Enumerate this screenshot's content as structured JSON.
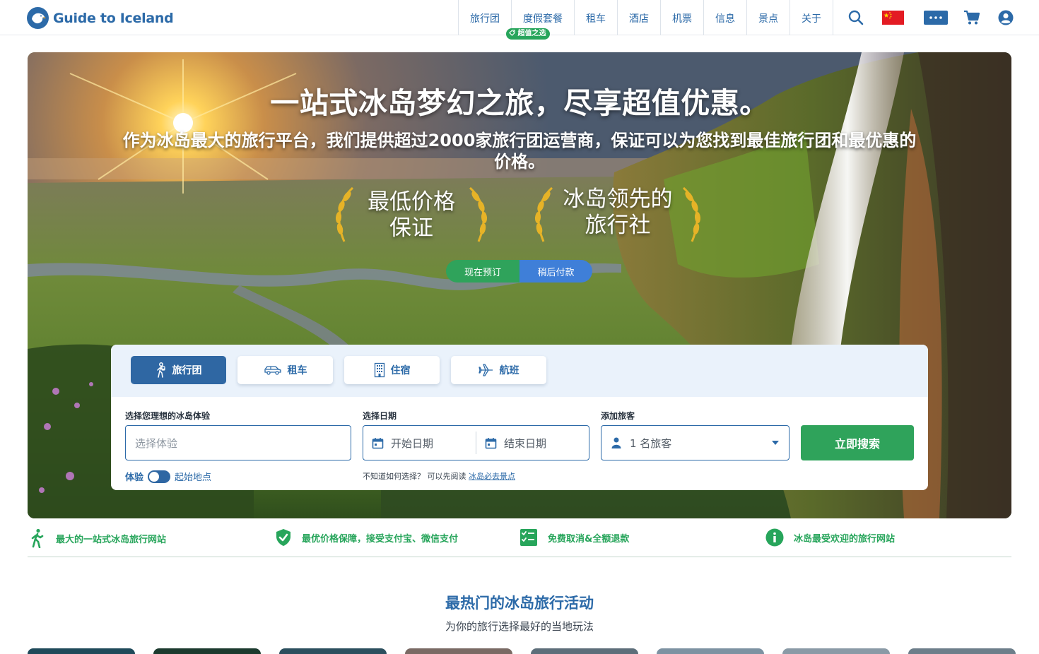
{
  "brand": {
    "name": "Guide to Iceland",
    "color": "#2c6aa8"
  },
  "nav": {
    "items": [
      "旅行团",
      "度假套餐",
      "租车",
      "酒店",
      "机票",
      "信息",
      "景点",
      "关于"
    ],
    "badge": "超值之选",
    "icons": [
      "search-icon",
      "china-flag-icon",
      "more-menu-icon",
      "cart-icon",
      "user-account-icon"
    ]
  },
  "hero": {
    "title": "一站式冰岛梦幻之旅，尽享超值优惠。",
    "subtitle": "作为冰岛最大的旅行平台，我们提供超过2000家旅行团运营商，保证可以为您找到最佳旅行团和最优惠的价格。",
    "award_1": [
      "最低价格",
      "保证"
    ],
    "award_2": [
      "冰岛领先的",
      "旅行社"
    ],
    "pay_now": "现在预订",
    "pay_later": "稍后付款"
  },
  "search": {
    "tabs": [
      {
        "label": "旅行团",
        "icon": "hiker-icon",
        "active": true
      },
      {
        "label": "租车",
        "icon": "car-icon",
        "active": false
      },
      {
        "label": "住宿",
        "icon": "building-icon",
        "active": false
      },
      {
        "label": "航班",
        "icon": "plane-icon",
        "active": false
      }
    ],
    "experience_label": "选择您理想的冰岛体验",
    "experience_placeholder": "选择体验",
    "date_label": "选择日期",
    "start_date": "开始日期",
    "end_date": "结束日期",
    "travelers_label": "添加旅客",
    "travelers_value": "1 名旅客",
    "button": "立即搜索",
    "toggle_left": "体验",
    "toggle_right": "起始地点",
    "hint_text": "不知道如何选择？ 可以先阅读",
    "hint_link": "冰岛必去景点"
  },
  "usp": [
    {
      "text": "最大的一站式冰岛旅行网站",
      "icon": "hiker-icon"
    },
    {
      "text": "最优价格保障，接受支付宝、微信支付",
      "icon": "shield-check-icon"
    },
    {
      "text": "免费取消&全额退款",
      "icon": "checklist-icon"
    },
    {
      "text": "冰岛最受欢迎的旅行网站",
      "icon": "info-icon"
    }
  ],
  "section": {
    "title": "最热门的冰岛旅行活动",
    "subtitle": "为你的旅行选择最好的当地玩法"
  },
  "colors": {
    "green": "#2fa35b",
    "blue": "#2c6aa8",
    "light_blue": "#eaf2fb"
  }
}
